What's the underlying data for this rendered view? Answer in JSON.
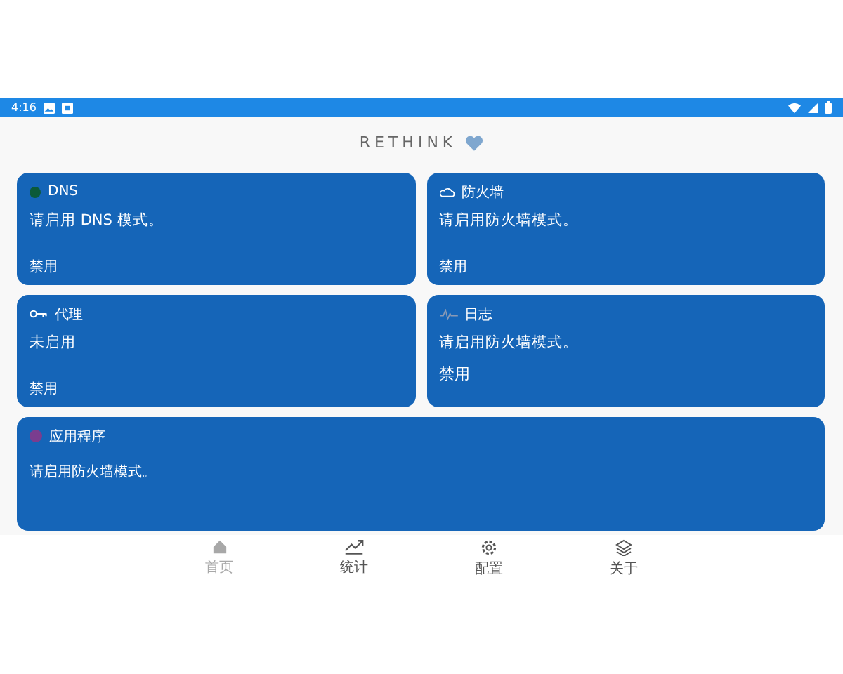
{
  "status_bar": {
    "time": "4:16"
  },
  "header": {
    "title": "RETHINK"
  },
  "cards": [
    {
      "kind": "dns",
      "title": "DNS",
      "message": "请启用 DNS 模式。",
      "status": "禁用"
    },
    {
      "kind": "firewall",
      "title": "防火墙",
      "message": "请启用防火墙模式。",
      "status": "禁用"
    },
    {
      "kind": "proxy",
      "title": "代理",
      "message": "未启用",
      "status": "禁用"
    },
    {
      "kind": "logs",
      "title": "日志",
      "message": "请启用防火墙模式。",
      "status": "禁用"
    },
    {
      "kind": "apps",
      "title": "应用程序",
      "message": "请启用防火墙模式。"
    }
  ],
  "bottom_nav": [
    {
      "kind": "home",
      "label": "首页",
      "selected": true
    },
    {
      "kind": "stats",
      "label": "统计",
      "selected": false
    },
    {
      "kind": "config",
      "label": "配置",
      "selected": false
    },
    {
      "kind": "about",
      "label": "关于",
      "selected": false
    }
  ]
}
